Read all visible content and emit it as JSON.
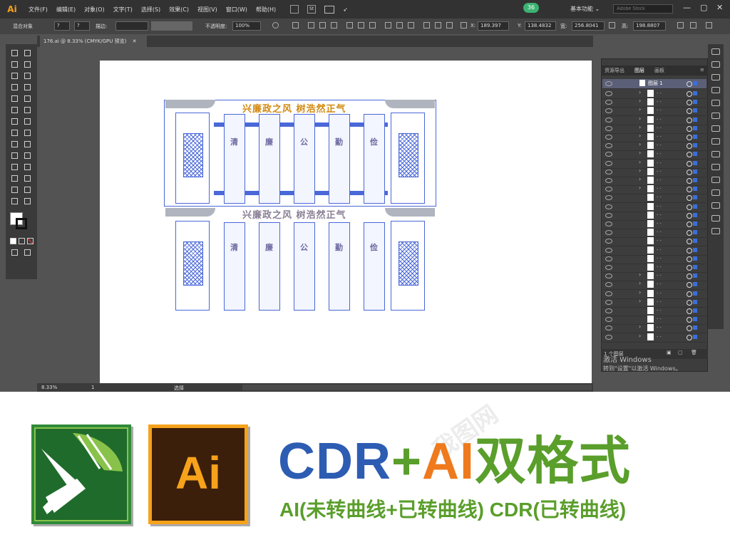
{
  "app": {
    "logo": "Ai",
    "menus": [
      "文件(F)",
      "编辑(E)",
      "对象(O)",
      "文字(T)",
      "选择(S)",
      "效果(C)",
      "视图(V)",
      "窗口(W)",
      "帮助(H)"
    ],
    "notification_count": "36",
    "workspace": "基本功能",
    "stock_search_placeholder": "Adobe Stock",
    "window_controls": [
      "—",
      "▢",
      "✕"
    ]
  },
  "control_bar": {
    "object_type": "混合对象",
    "stroke_label": "描边:",
    "opacity_label": "不透明度:",
    "opacity_value": "100%",
    "x_label": "X:",
    "x_value": "189.397",
    "y_label": "Y:",
    "y_value": "138.4832",
    "w_label": "宽:",
    "w_value": "256.8041",
    "h_label": "高:",
    "h_value": "198.8807"
  },
  "document": {
    "tab_title": "176.ai @ 8.33% (CMYK/GPU 预览)"
  },
  "artwork": {
    "title_top": "兴廉政之风  树浩然正气",
    "title_bottom": "兴廉政之风  树浩然正气",
    "scroll_top": [
      "清",
      "廉",
      "公",
      "勤",
      "俭"
    ],
    "scroll_bottom": [
      "清",
      "廉",
      "公",
      "勤",
      "俭"
    ]
  },
  "layers_panel": {
    "tabs": [
      "资源导出",
      "图层",
      "画板"
    ],
    "active_tab": "图层",
    "main_layer": "图层 1",
    "footer_label": "1 个图层",
    "sublayer_count": 30
  },
  "status": {
    "zoom": "8.33%",
    "artboard_number": "1",
    "tool": "选择"
  },
  "activation": {
    "line1": "激活 Windows",
    "line2": "转到\"设置\"以激活 Windows。"
  },
  "banner": {
    "cdr_part": "CDR",
    "plus1": "+",
    "ai_part": "AI",
    "cn_part": "双格式",
    "sub": "AI(未转曲线+已转曲线) CDR(已转曲线)",
    "ai_icon_text": "Ai"
  },
  "colors": {
    "ai_orange": "#f7a21b",
    "cdr_green": "#2f8a3a",
    "headline_blue": "#2d5cb3",
    "headline_green": "#5a9e2b",
    "headline_orange": "#ee7a1d",
    "selection_blue": "#4a68d8"
  }
}
